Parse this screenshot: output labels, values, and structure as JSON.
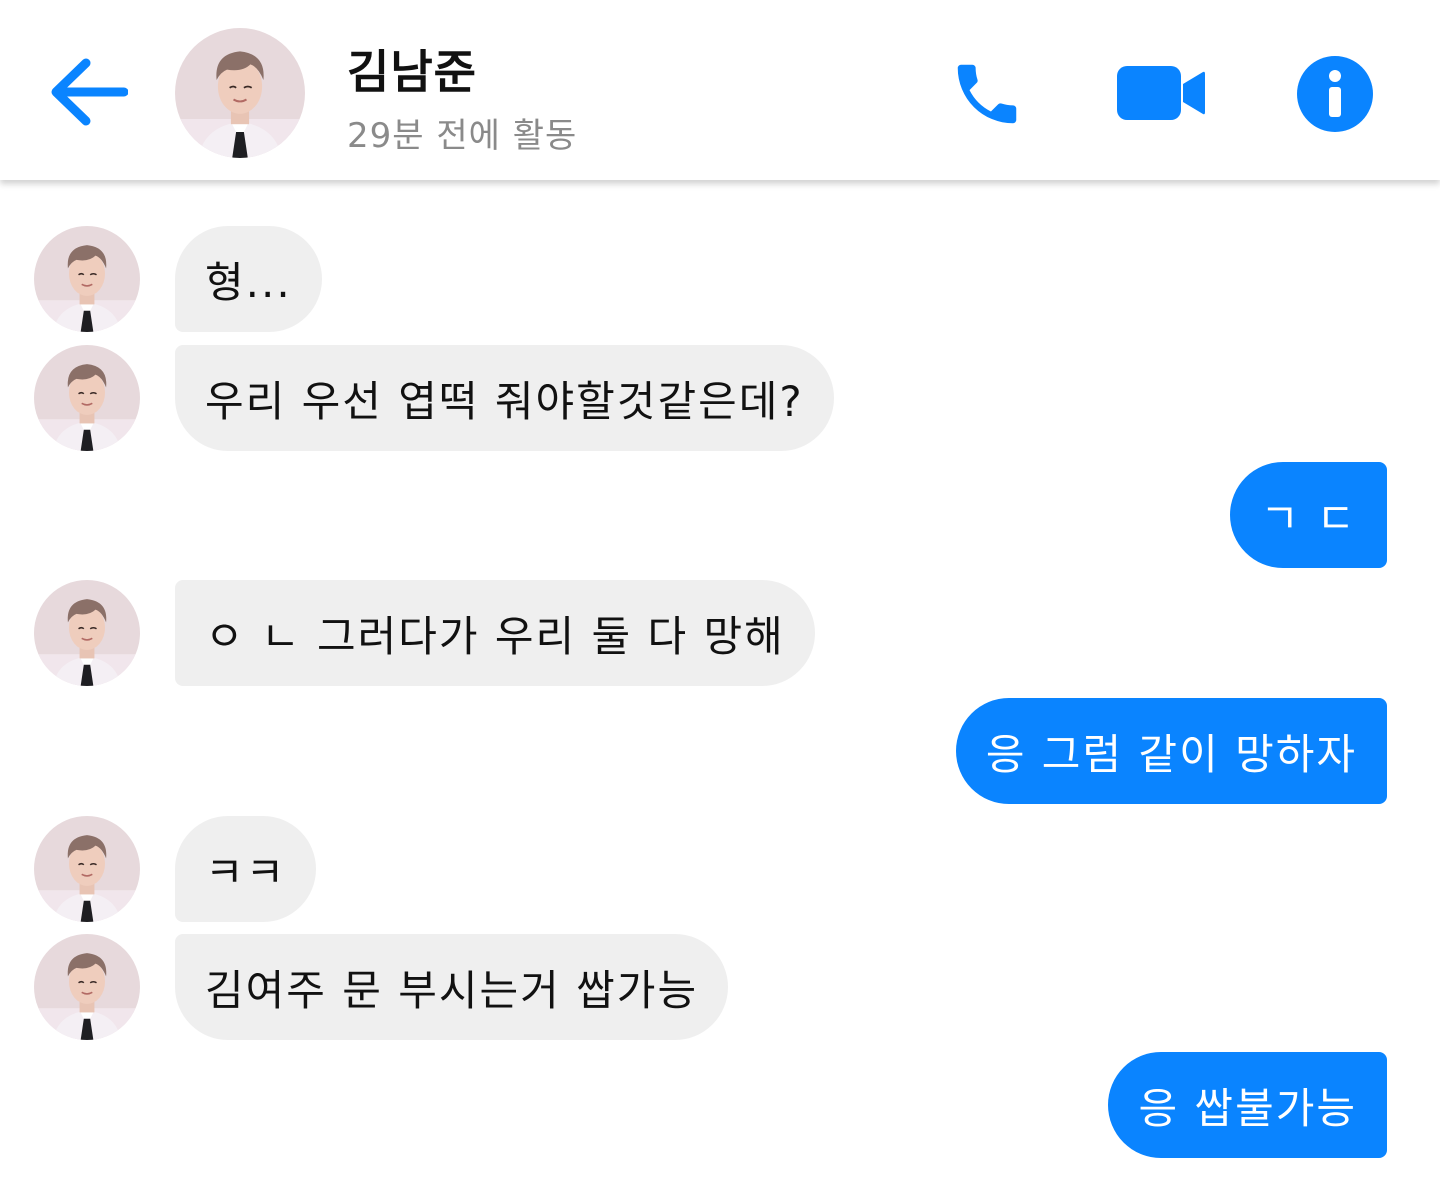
{
  "header": {
    "name": "김남준",
    "status": "29분 전에 활동",
    "back_icon": "arrow-left-icon",
    "actions": [
      "phone-icon",
      "video-camera-icon",
      "info-icon"
    ]
  },
  "colors": {
    "accent": "#0a84ff",
    "incoming_bubble": "#efefef",
    "status_text": "#8a8a8a"
  },
  "messages": [
    {
      "side": "incoming",
      "text": "형..."
    },
    {
      "side": "incoming",
      "text": "우리 우선 엽떡 줘야할것같은데?"
    },
    {
      "side": "outgoing",
      "text": "ㄱ ㄷ"
    },
    {
      "side": "incoming",
      "text": "ㅇ ㄴ 그러다가 우리 둘 다 망해"
    },
    {
      "side": "outgoing",
      "text": "응 그럼 같이 망하자"
    },
    {
      "side": "incoming",
      "text": "ㅋㅋ"
    },
    {
      "side": "incoming",
      "text": "김여주 문 부시는거 쌉가능"
    },
    {
      "side": "outgoing",
      "text": "응 쌉불가능"
    }
  ]
}
